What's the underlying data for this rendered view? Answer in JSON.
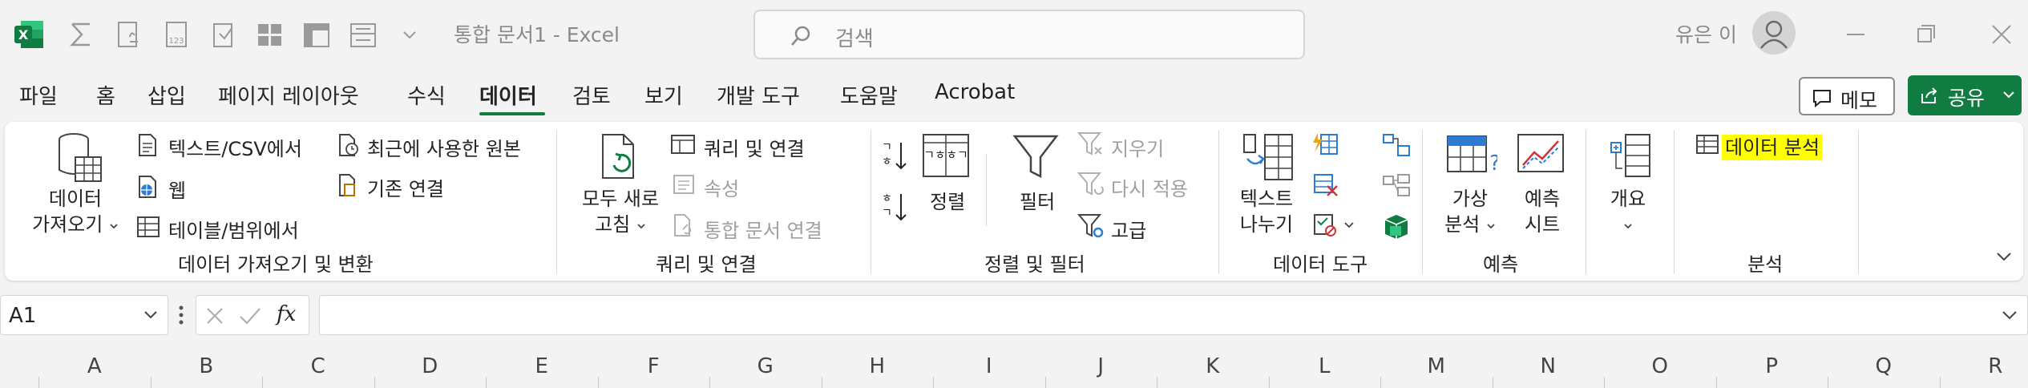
{
  "titlebar": {
    "doc_title": "통합 문서1  -  Excel",
    "search_placeholder": "검색",
    "user_name": "유은 이"
  },
  "menu": {
    "tabs": [
      "파일",
      "홈",
      "삽입",
      "페이지 레이아웃",
      "수식",
      "데이터",
      "검토",
      "보기",
      "개발 도구",
      "도움말",
      "Acrobat"
    ],
    "active_tab": "데이터",
    "memo_label": "메모",
    "share_label": "공유"
  },
  "ribbon": {
    "get_data": {
      "get_data_line1": "데이터",
      "get_data_line2": "가져오기",
      "text_csv": "텍스트/CSV에서",
      "web": "웹",
      "table_range": "테이블/범위에서",
      "recent_sources": "최근에 사용한 원본",
      "existing_connections": "기존 연결",
      "group_label": "데이터 가져오기 및 변환"
    },
    "queries": {
      "refresh_line1": "모두 새로",
      "refresh_line2": "고침",
      "queries_connections": "쿼리 및 연결",
      "properties": "속성",
      "edit_links": "통합 문서 연결",
      "group_label": "쿼리 및 연결"
    },
    "sort_filter": {
      "sort": "정렬",
      "filter": "필터",
      "clear": "지우기",
      "reapply": "다시 적용",
      "advanced": "고급",
      "group_label": "정렬 및 필터",
      "sort_icon_az": "ㄱㅎ",
      "sort_icon_za": "ㅎㄱ"
    },
    "data_tools": {
      "text_to_columns_line1": "텍스트",
      "text_to_columns_line2": "나누기",
      "group_label": "데이터 도구"
    },
    "forecast": {
      "whatif_line1": "가상",
      "whatif_line2": "분석",
      "sheet_line1": "예측",
      "sheet_line2": "시트",
      "group_label": "예측"
    },
    "outline": {
      "outline": "개요"
    },
    "analysis": {
      "data_analysis": "데이터 분석",
      "group_label": "분석"
    }
  },
  "formula_bar": {
    "name_box": "A1",
    "fx": "fx",
    "formula_value": ""
  },
  "columns": [
    "A",
    "B",
    "C",
    "D",
    "E",
    "F",
    "G",
    "H",
    "I",
    "J",
    "K",
    "L",
    "M",
    "N",
    "O",
    "P",
    "Q",
    "R"
  ],
  "colors": {
    "excel_green": "#107c41",
    "highlight": "#ffff00"
  }
}
